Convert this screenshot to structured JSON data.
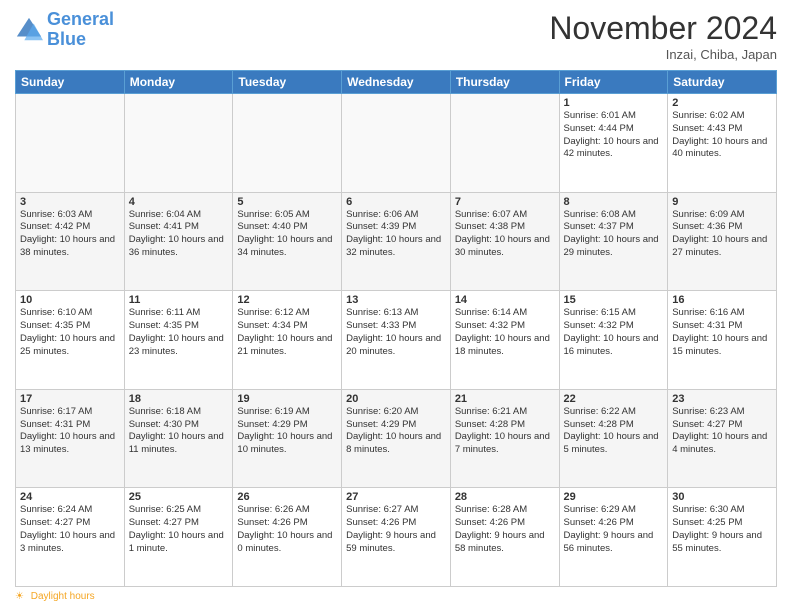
{
  "header": {
    "logo_line1": "General",
    "logo_line2": "Blue",
    "month_title": "November 2024",
    "location": "Inzai, Chiba, Japan"
  },
  "weekdays": [
    "Sunday",
    "Monday",
    "Tuesday",
    "Wednesday",
    "Thursday",
    "Friday",
    "Saturday"
  ],
  "weeks": [
    [
      {
        "day": "",
        "info": ""
      },
      {
        "day": "",
        "info": ""
      },
      {
        "day": "",
        "info": ""
      },
      {
        "day": "",
        "info": ""
      },
      {
        "day": "",
        "info": ""
      },
      {
        "day": "1",
        "info": "Sunrise: 6:01 AM\nSunset: 4:44 PM\nDaylight: 10 hours and 42 minutes."
      },
      {
        "day": "2",
        "info": "Sunrise: 6:02 AM\nSunset: 4:43 PM\nDaylight: 10 hours and 40 minutes."
      }
    ],
    [
      {
        "day": "3",
        "info": "Sunrise: 6:03 AM\nSunset: 4:42 PM\nDaylight: 10 hours and 38 minutes."
      },
      {
        "day": "4",
        "info": "Sunrise: 6:04 AM\nSunset: 4:41 PM\nDaylight: 10 hours and 36 minutes."
      },
      {
        "day": "5",
        "info": "Sunrise: 6:05 AM\nSunset: 4:40 PM\nDaylight: 10 hours and 34 minutes."
      },
      {
        "day": "6",
        "info": "Sunrise: 6:06 AM\nSunset: 4:39 PM\nDaylight: 10 hours and 32 minutes."
      },
      {
        "day": "7",
        "info": "Sunrise: 6:07 AM\nSunset: 4:38 PM\nDaylight: 10 hours and 30 minutes."
      },
      {
        "day": "8",
        "info": "Sunrise: 6:08 AM\nSunset: 4:37 PM\nDaylight: 10 hours and 29 minutes."
      },
      {
        "day": "9",
        "info": "Sunrise: 6:09 AM\nSunset: 4:36 PM\nDaylight: 10 hours and 27 minutes."
      }
    ],
    [
      {
        "day": "10",
        "info": "Sunrise: 6:10 AM\nSunset: 4:35 PM\nDaylight: 10 hours and 25 minutes."
      },
      {
        "day": "11",
        "info": "Sunrise: 6:11 AM\nSunset: 4:35 PM\nDaylight: 10 hours and 23 minutes."
      },
      {
        "day": "12",
        "info": "Sunrise: 6:12 AM\nSunset: 4:34 PM\nDaylight: 10 hours and 21 minutes."
      },
      {
        "day": "13",
        "info": "Sunrise: 6:13 AM\nSunset: 4:33 PM\nDaylight: 10 hours and 20 minutes."
      },
      {
        "day": "14",
        "info": "Sunrise: 6:14 AM\nSunset: 4:32 PM\nDaylight: 10 hours and 18 minutes."
      },
      {
        "day": "15",
        "info": "Sunrise: 6:15 AM\nSunset: 4:32 PM\nDaylight: 10 hours and 16 minutes."
      },
      {
        "day": "16",
        "info": "Sunrise: 6:16 AM\nSunset: 4:31 PM\nDaylight: 10 hours and 15 minutes."
      }
    ],
    [
      {
        "day": "17",
        "info": "Sunrise: 6:17 AM\nSunset: 4:31 PM\nDaylight: 10 hours and 13 minutes."
      },
      {
        "day": "18",
        "info": "Sunrise: 6:18 AM\nSunset: 4:30 PM\nDaylight: 10 hours and 11 minutes."
      },
      {
        "day": "19",
        "info": "Sunrise: 6:19 AM\nSunset: 4:29 PM\nDaylight: 10 hours and 10 minutes."
      },
      {
        "day": "20",
        "info": "Sunrise: 6:20 AM\nSunset: 4:29 PM\nDaylight: 10 hours and 8 minutes."
      },
      {
        "day": "21",
        "info": "Sunrise: 6:21 AM\nSunset: 4:28 PM\nDaylight: 10 hours and 7 minutes."
      },
      {
        "day": "22",
        "info": "Sunrise: 6:22 AM\nSunset: 4:28 PM\nDaylight: 10 hours and 5 minutes."
      },
      {
        "day": "23",
        "info": "Sunrise: 6:23 AM\nSunset: 4:27 PM\nDaylight: 10 hours and 4 minutes."
      }
    ],
    [
      {
        "day": "24",
        "info": "Sunrise: 6:24 AM\nSunset: 4:27 PM\nDaylight: 10 hours and 3 minutes."
      },
      {
        "day": "25",
        "info": "Sunrise: 6:25 AM\nSunset: 4:27 PM\nDaylight: 10 hours and 1 minute."
      },
      {
        "day": "26",
        "info": "Sunrise: 6:26 AM\nSunset: 4:26 PM\nDaylight: 10 hours and 0 minutes."
      },
      {
        "day": "27",
        "info": "Sunrise: 6:27 AM\nSunset: 4:26 PM\nDaylight: 9 hours and 59 minutes."
      },
      {
        "day": "28",
        "info": "Sunrise: 6:28 AM\nSunset: 4:26 PM\nDaylight: 9 hours and 58 minutes."
      },
      {
        "day": "29",
        "info": "Sunrise: 6:29 AM\nSunset: 4:26 PM\nDaylight: 9 hours and 56 minutes."
      },
      {
        "day": "30",
        "info": "Sunrise: 6:30 AM\nSunset: 4:25 PM\nDaylight: 9 hours and 55 minutes."
      }
    ]
  ],
  "footer": {
    "icon": "☀",
    "label": "Daylight hours"
  }
}
